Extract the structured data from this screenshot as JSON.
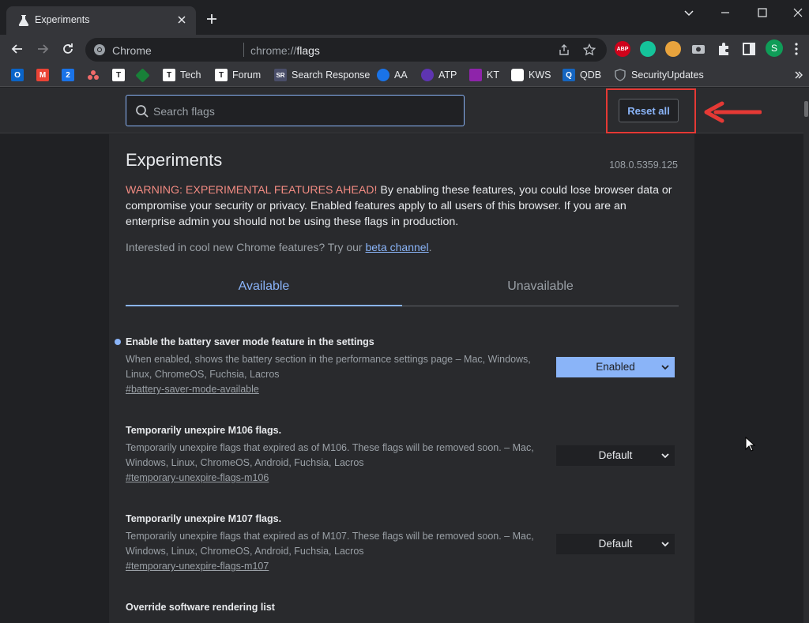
{
  "tab": {
    "title": "Experiments"
  },
  "omnibox": {
    "origin": "Chrome",
    "url_scheme": "chrome://",
    "url_path": "flags"
  },
  "extensions": {
    "abp_label": "ABP",
    "profile_initial": "S"
  },
  "bookmarks": [
    {
      "icon": "outlook-icon",
      "label": "",
      "color": "#0a64c8",
      "glyph": "O"
    },
    {
      "icon": "gmail-icon",
      "label": "",
      "color": "#ea4335",
      "glyph": "M"
    },
    {
      "icon": "calendar-icon",
      "label": "",
      "color": "#1a73e8",
      "glyph": "2"
    },
    {
      "icon": "asana-icon",
      "label": "",
      "color": "#f06a6a",
      "glyph": ""
    },
    {
      "icon": "tt-icon",
      "label": "",
      "color": "#ffffff",
      "glyph": "T"
    },
    {
      "icon": "green-diamond-icon",
      "label": "",
      "color": "#188038",
      "glyph": ""
    },
    {
      "icon": "tt-icon",
      "label": "Tech",
      "color": "#ffffff",
      "glyph": "T"
    },
    {
      "icon": "tt-icon",
      "label": "Forum",
      "color": "#ffffff",
      "glyph": "T"
    },
    {
      "icon": "sr-icon",
      "label": "Search Response",
      "color": "#4a4e69",
      "glyph": "SR"
    },
    {
      "icon": "eye-icon",
      "label": "AA",
      "color": "#1a73e8",
      "glyph": ""
    },
    {
      "icon": "hand-icon",
      "label": "ATP",
      "color": "#5e35b1",
      "glyph": ""
    },
    {
      "icon": "kt-icon",
      "label": "KT",
      "color": "#8e24aa",
      "glyph": ""
    },
    {
      "icon": "kws-icon",
      "label": "KWS",
      "color": "#ffffff",
      "glyph": ""
    },
    {
      "icon": "qdb-icon",
      "label": "QDB",
      "color": "#1565c0",
      "glyph": "Q"
    },
    {
      "icon": "shield-icon",
      "label": "SecurityUpdates",
      "color": "#9aa0a6",
      "glyph": ""
    }
  ],
  "flags_page": {
    "search_placeholder": "Search flags",
    "reset_label": "Reset all",
    "title": "Experiments",
    "version": "108.0.5359.125",
    "warning_label": "WARNING: EXPERIMENTAL FEATURES AHEAD!",
    "warning_text": " By enabling these features, you could lose browser data or compromise your security or privacy. Enabled features apply to all users of this browser. If you are an enterprise admin you should not be using these flags in production.",
    "interest_text": "Interested in cool new Chrome features? Try our ",
    "beta_link": "beta channel",
    "interest_end": ".",
    "tabs": {
      "available": "Available",
      "unavailable": "Unavailable"
    },
    "flags": [
      {
        "name": "Enable the battery saver mode feature in the settings",
        "desc": "When enabled, shows the battery section in the performance settings page – Mac, Windows, Linux, ChromeOS, Fuchsia, Lacros",
        "link": "#battery-saver-mode-available",
        "value": "Enabled"
      },
      {
        "name": "Temporarily unexpire M106 flags.",
        "desc": "Temporarily unexpire flags that expired as of M106. These flags will be removed soon. – Mac, Windows, Linux, ChromeOS, Android, Fuchsia, Lacros",
        "link": "#temporary-unexpire-flags-m106",
        "value": "Default"
      },
      {
        "name": "Temporarily unexpire M107 flags.",
        "desc": "Temporarily unexpire flags that expired as of M107. These flags will be removed soon. – Mac, Windows, Linux, ChromeOS, Android, Fuchsia, Lacros",
        "link": "#temporary-unexpire-flags-m107",
        "value": "Default"
      },
      {
        "name": "Override software rendering list"
      }
    ]
  }
}
